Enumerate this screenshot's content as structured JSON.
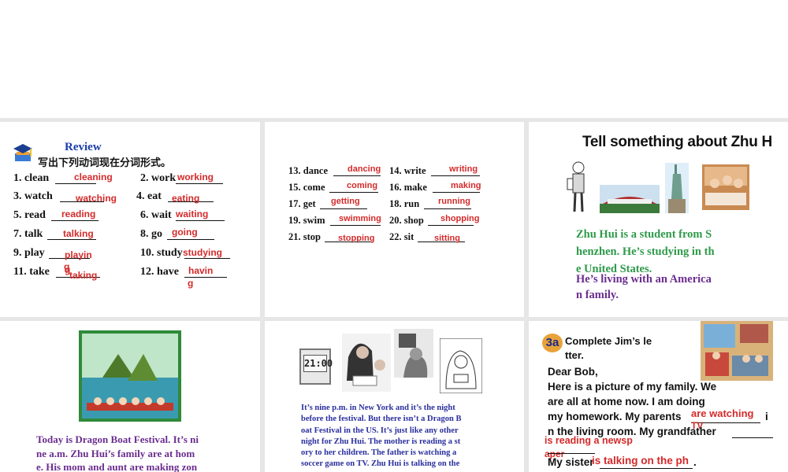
{
  "slide1": {
    "title": "Review",
    "instruction": "写出下列动词现在分词形式。",
    "items": [
      {
        "label": "1. clean",
        "answer": "cleaning"
      },
      {
        "label": "2. work",
        "answer": "working"
      },
      {
        "label": "3. watch",
        "answer": "watching"
      },
      {
        "label": "4. eat",
        "answer": "eating"
      },
      {
        "label": "5. read",
        "answer": "reading"
      },
      {
        "label": "6. wait",
        "answer": "waiting"
      },
      {
        "label": "7. talk",
        "answer": "talking"
      },
      {
        "label": "8. go",
        "answer": "going"
      },
      {
        "label": "9. play",
        "answer": "playin",
        "answer_wrap": "g"
      },
      {
        "label": "10. study",
        "answer": "studying"
      },
      {
        "label": "11. take",
        "answer": "taking",
        "answer_wrap": "g"
      },
      {
        "label": "12. have",
        "answer": "havin",
        "answer_wrap": "g"
      }
    ]
  },
  "slide2": {
    "items": [
      {
        "label": "13. dance",
        "answer": "dancing"
      },
      {
        "label": "14. write",
        "answer": "writing"
      },
      {
        "label": "15. come",
        "answer": "coming"
      },
      {
        "label": "16. make",
        "answer": "making"
      },
      {
        "label": "17. get",
        "answer": "getting"
      },
      {
        "label": "18. run",
        "answer": "running"
      },
      {
        "label": "19. swim",
        "answer": "swimming"
      },
      {
        "label": "20. shop",
        "answer": "shopping"
      },
      {
        "label": "21. stop",
        "answer": "stopping"
      },
      {
        "label": "22. sit",
        "answer": "sitting"
      }
    ]
  },
  "slide3": {
    "heading": "Tell something about Zhu H",
    "green_lines": [
      "Zhu Hui is a student from S",
      "henzhen. He’s studying in th",
      "e United States."
    ],
    "purple_lines": [
      "He’s living with an America",
      "n family."
    ]
  },
  "slide4": {
    "lines": [
      "Today is Dragon Boat Festival. It’s ni",
      "ne a.m.  Zhu Hui’s family are at hom",
      "e. His mom and aunt are making zon"
    ]
  },
  "slide5": {
    "clock_display": "21:00",
    "lines": [
      "It’s nine p.m. in New York and it’s the night",
      "before the festival. But there isn’t a Dragon B",
      "oat Festival in the US. It’s just like any other",
      "night for Zhu Hui. The mother is reading a st",
      "ory to her children. The father is watching a",
      "soccer game on TV. Zhu Hui is talking on the"
    ]
  },
  "slide6": {
    "badge": "3a",
    "title_lines": [
      "Complete Jim’s le",
      "tter."
    ],
    "greeting": "Dear Bob,",
    "body_lines": [
      "Here is a picture of my family. We",
      "are all at home now. I am doing",
      "my homework. My parents",
      "n the living room. My grandfather"
    ],
    "line3_tail": "i",
    "answers": {
      "parents_a": "are watching",
      "parents_b": "TV",
      "grandfather_a": "is reading a newsp",
      "grandfather_b": "aper"
    },
    "sister_label": "My sister",
    "sister_answer": "is talking on the ph",
    "sister_end": "."
  },
  "colors": {
    "answer": "#d42a2a",
    "review_title": "#1a3ea8",
    "green_text": "#2e9a4a",
    "purple_text": "#6b2d8f",
    "blue_text": "#2a2f9e"
  }
}
